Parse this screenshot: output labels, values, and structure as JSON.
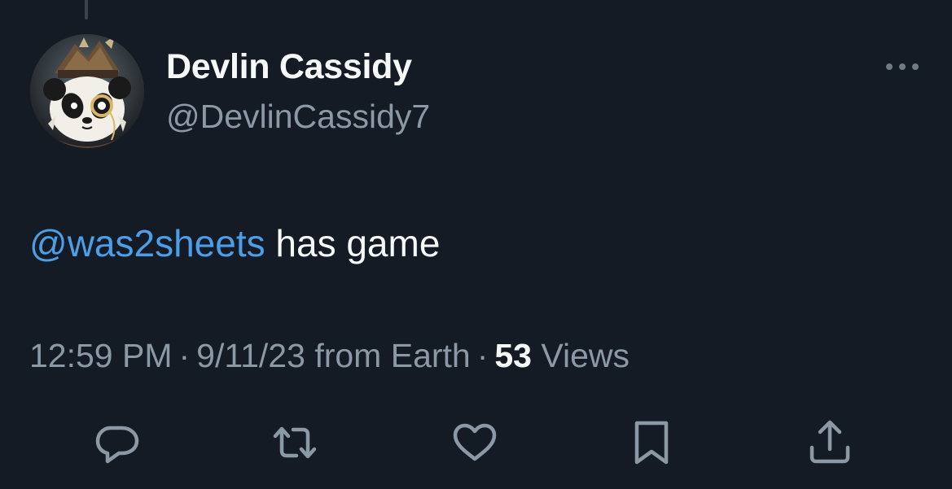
{
  "author": {
    "display_name": "Devlin Cassidy",
    "handle": "@DevlinCassidy7",
    "avatar_icon": "panda-avatar"
  },
  "tweet": {
    "mention": "@was2sheets",
    "text": " has game"
  },
  "meta": {
    "time": "12:59 PM",
    "separator": "·",
    "date": "9/11/23",
    "source": "from Earth",
    "views_count": "53",
    "views_label": "Views"
  },
  "actions": [
    {
      "icon": "reply-icon"
    },
    {
      "icon": "retweet-icon"
    },
    {
      "icon": "like-icon"
    },
    {
      "icon": "bookmark-icon"
    },
    {
      "icon": "share-icon"
    }
  ],
  "colors": {
    "background": "#151b24",
    "mention": "#4b9ee8",
    "secondary_text": "#8b98a5",
    "primary_text": "#f7f9f9"
  }
}
